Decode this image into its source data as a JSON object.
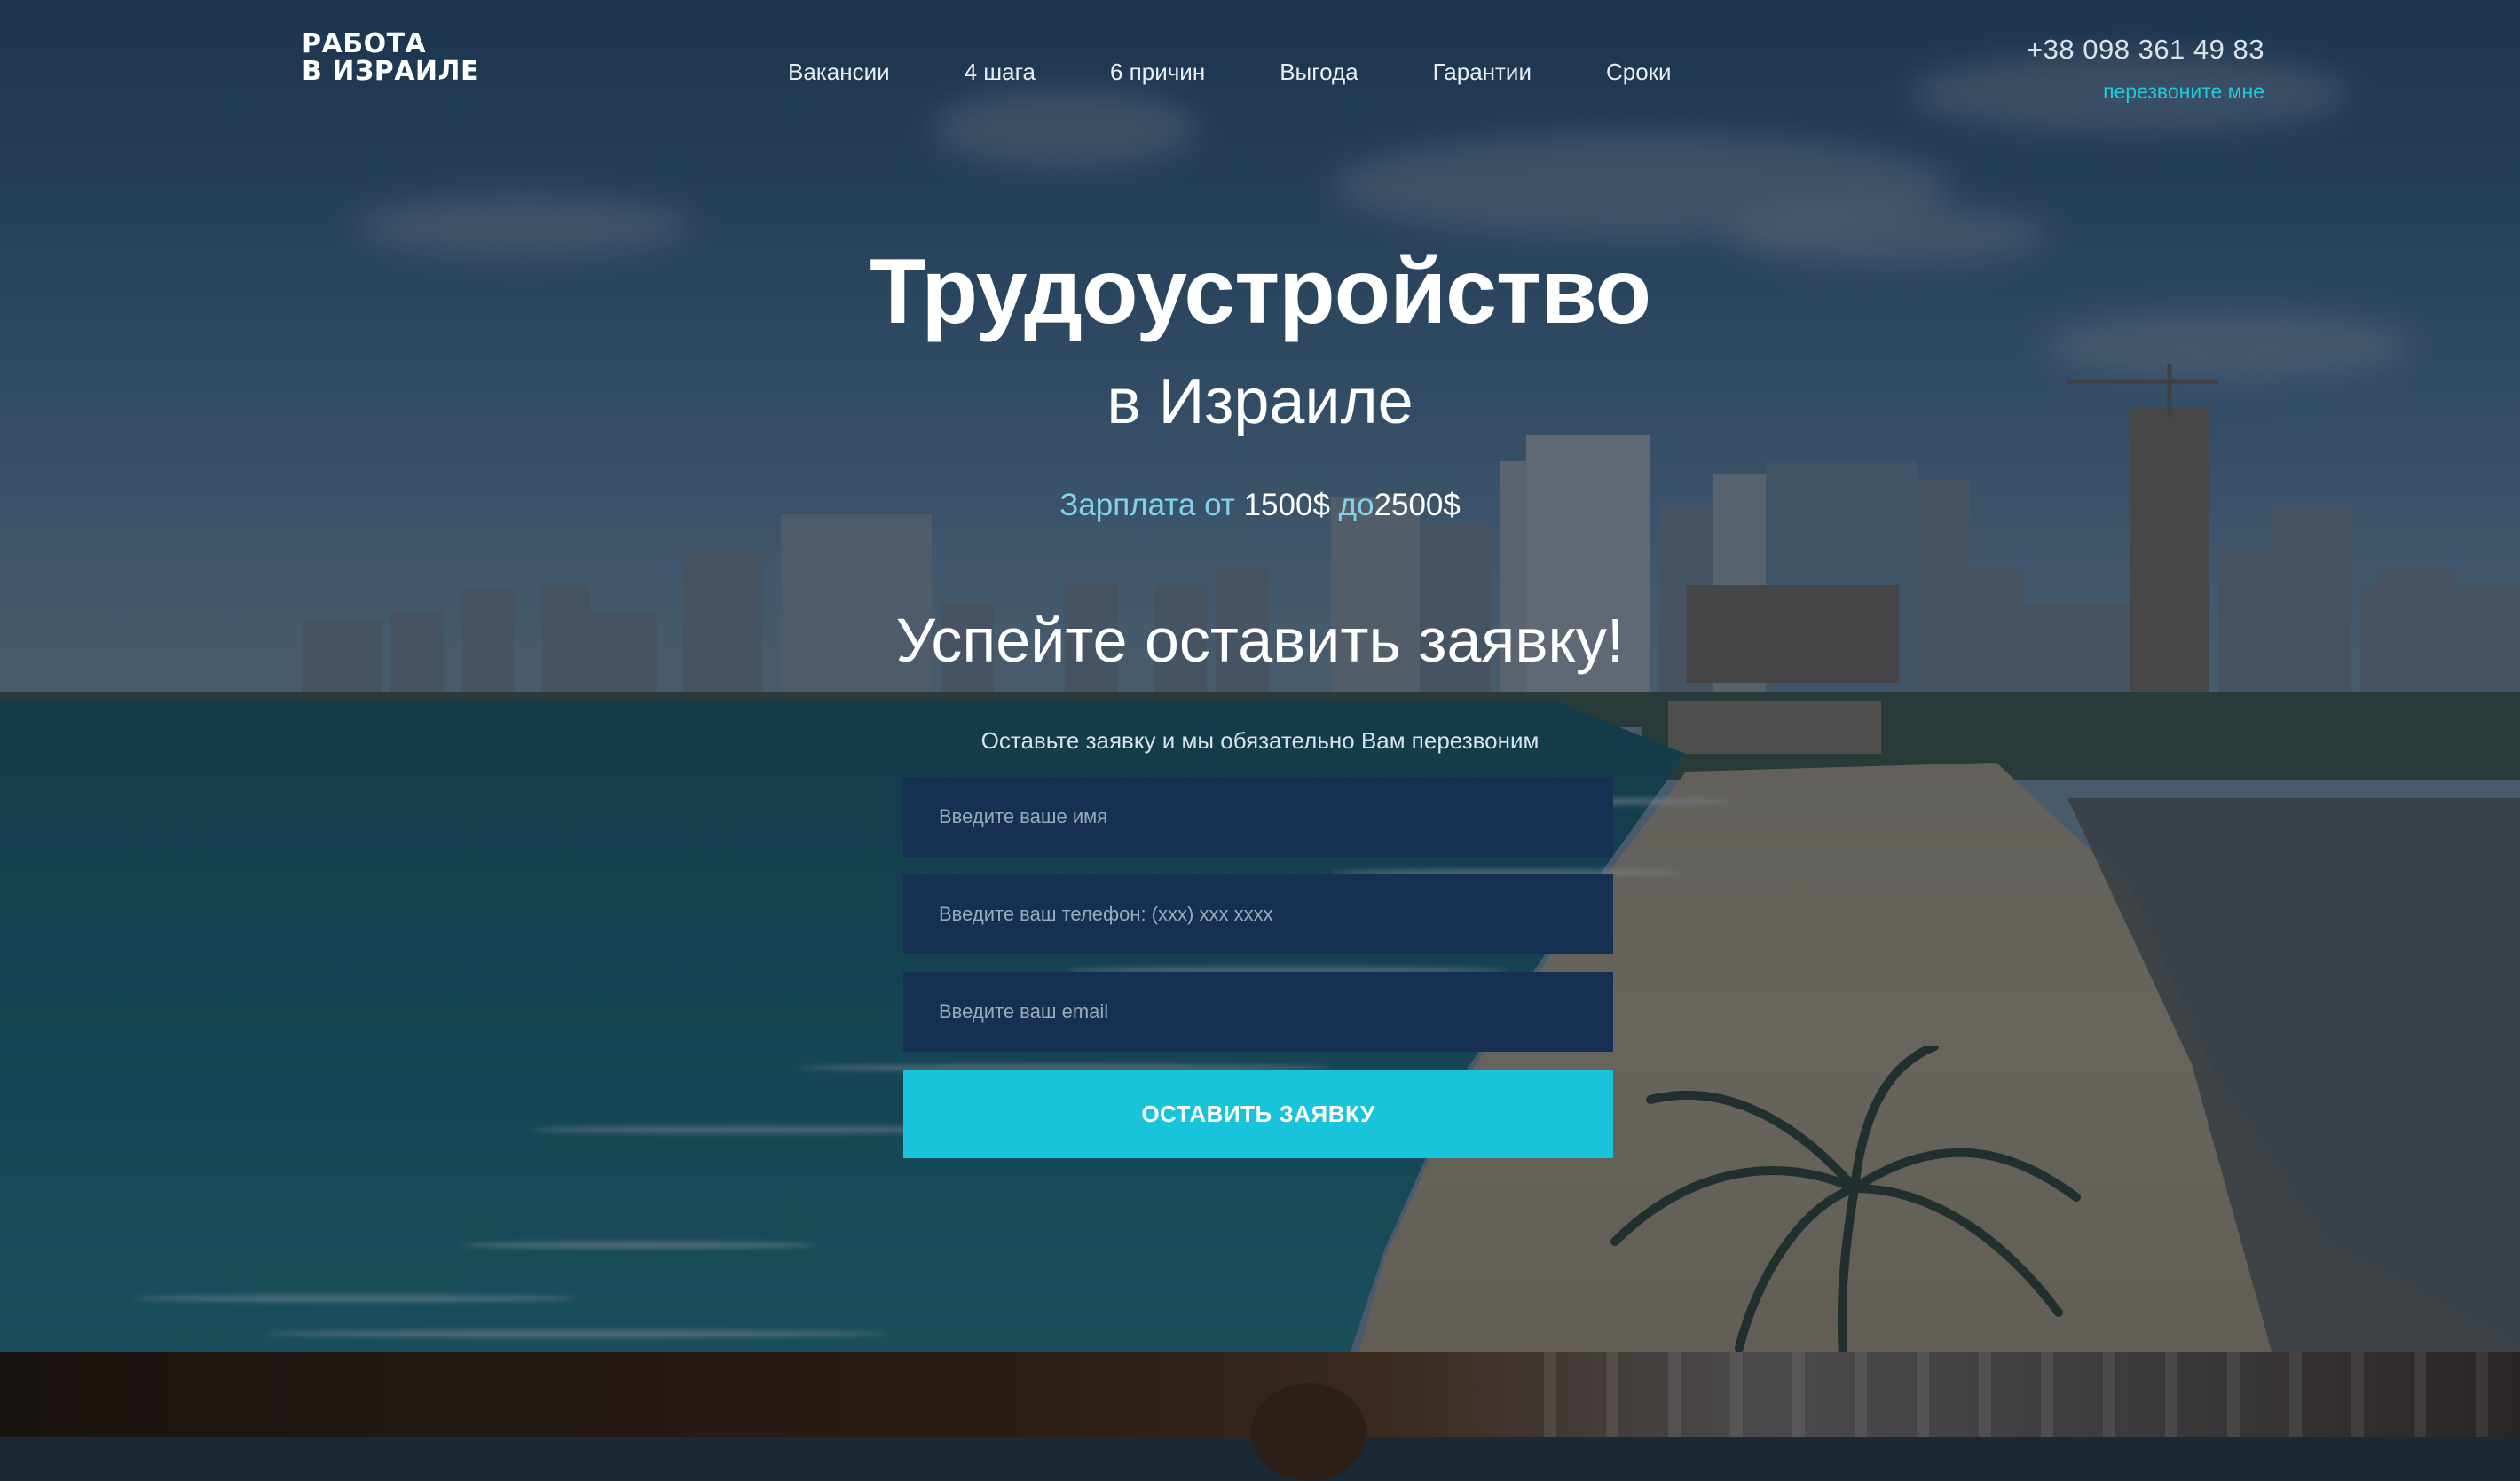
{
  "header": {
    "logo_line1": "РАБОТА",
    "logo_line2": "В ИЗРАИЛЕ",
    "nav": [
      {
        "label": "Вакансии"
      },
      {
        "label": "4 шага"
      },
      {
        "label": "6 причин"
      },
      {
        "label": "Выгода"
      },
      {
        "label": "Гарантии"
      },
      {
        "label": "Сроки"
      }
    ],
    "phone": "+38 098 361 49 83",
    "callback_label": "перезвоните мне"
  },
  "hero": {
    "title": "Трудоустройство",
    "subtitle": "в Израиле",
    "salary_prefix": "Зарплата от",
    "salary_from": "1500$",
    "salary_mid": "до",
    "salary_to": "2500$",
    "cta_heading": "Успейте оставить заявку!",
    "cta_sub": "Оставьте заявку и мы обязательно Вам перезвоним"
  },
  "form": {
    "name_placeholder": "Введите ваше имя",
    "phone_placeholder": "Введите ваш телефон: (xxx) xxx xxxx",
    "email_placeholder": "Введите ваш email",
    "submit_label": "ОСТАВИТЬ ЗАЯВКУ"
  },
  "colors": {
    "accent": "#18c4dc",
    "field_bg": "#163053",
    "salary_highlight": "#7fd3ec"
  }
}
